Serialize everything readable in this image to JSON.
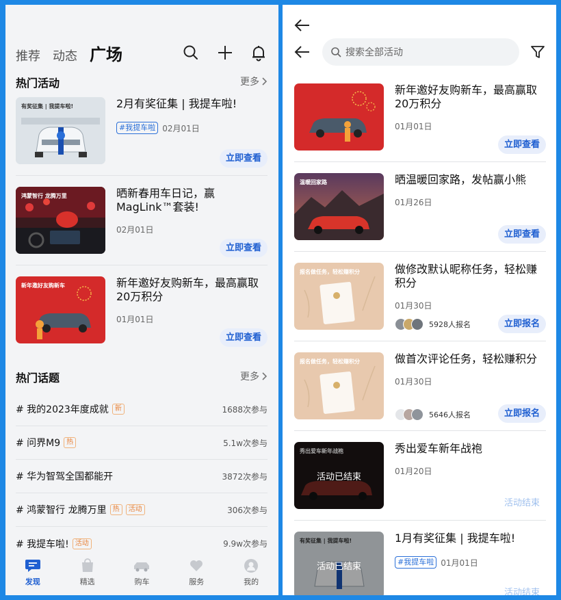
{
  "left": {
    "tabs": [
      "推荐",
      "动态",
      "广场"
    ],
    "hot_activities": {
      "title": "热门活动",
      "more": "更多",
      "items": [
        {
          "title": "2月有奖征集 | 我提车啦!",
          "tag": "#我提车啦",
          "date": "02月01日",
          "button": "立即查看",
          "thumb_text": "有奖征集 | 我提车啦!"
        },
        {
          "title": "晒新春用车日记，赢MagLink™套装!",
          "date": "02月01日",
          "button": "立即查看",
          "thumb_text": "鸿蒙智行 龙腾万里"
        },
        {
          "title": "新年邀好友购新车，最高赢取20万积分",
          "date": "01月01日",
          "button": "立即查看",
          "thumb_text": "新年邀好友购新车"
        }
      ]
    },
    "hot_topics": {
      "title": "热门话题",
      "more": "更多",
      "items": [
        {
          "name": "# 我的2023年度成就",
          "badges": [
            "新"
          ],
          "count": "1688次参与"
        },
        {
          "name": "# 问界M9",
          "badges": [
            "热"
          ],
          "count": "5.1w次参与"
        },
        {
          "name": "# 华为智驾全国都能开",
          "badges": [],
          "count": "3872次参与"
        },
        {
          "name": "# 鸿蒙智行 龙腾万里",
          "badges": [
            "热",
            "活动"
          ],
          "count": "306次参与"
        },
        {
          "name": "# 我提车啦!",
          "badges": [
            "活动"
          ],
          "count": "9.9w次参与"
        }
      ]
    },
    "nav": [
      {
        "label": "发现",
        "icon": "discover-icon",
        "active": true
      },
      {
        "label": "精选",
        "icon": "bag-icon",
        "active": false
      },
      {
        "label": "购车",
        "icon": "car-icon",
        "active": false
      },
      {
        "label": "服务",
        "icon": "heart-icon",
        "active": false
      },
      {
        "label": "我的",
        "icon": "profile-icon",
        "active": false
      }
    ]
  },
  "right": {
    "search_placeholder": "搜索全部活动",
    "items": [
      {
        "title": "新年邀好友购新车，最高赢取20万积分",
        "date": "01月01日",
        "button": "立即查看"
      },
      {
        "title": "晒温暖回家路，发帖赢小熊",
        "date": "01月26日",
        "button": "立即查看",
        "thumb_text": "温暖回家路"
      },
      {
        "title": "做修改默认昵称任务，轻松赚积分",
        "date": "01月30日",
        "signups": "5928人报名",
        "button": "立即报名",
        "thumb_text": "报名做任务，轻松赚积分"
      },
      {
        "title": "做首次评论任务，轻松赚积分",
        "date": "01月30日",
        "signups": "5646人报名",
        "button": "立即报名",
        "thumb_text": "报名做任务，轻松赚积分"
      },
      {
        "title": "秀出爱车新年战袍",
        "date": "01月20日",
        "button": "活动结束",
        "overlay": "活动已结束",
        "thumb_text": "秀出爱车新年战袍"
      },
      {
        "title": "1月有奖征集 | 我提车啦!",
        "tag": "#我提车啦",
        "date": "01月01日",
        "button": "活动结束",
        "overlay": "活动已结束",
        "thumb_text": "有奖征集 | 我提车啦!"
      }
    ]
  },
  "colors": {
    "accent": "#1f5fd1",
    "frame": "#1e88e5",
    "badge": "#e8833a"
  }
}
